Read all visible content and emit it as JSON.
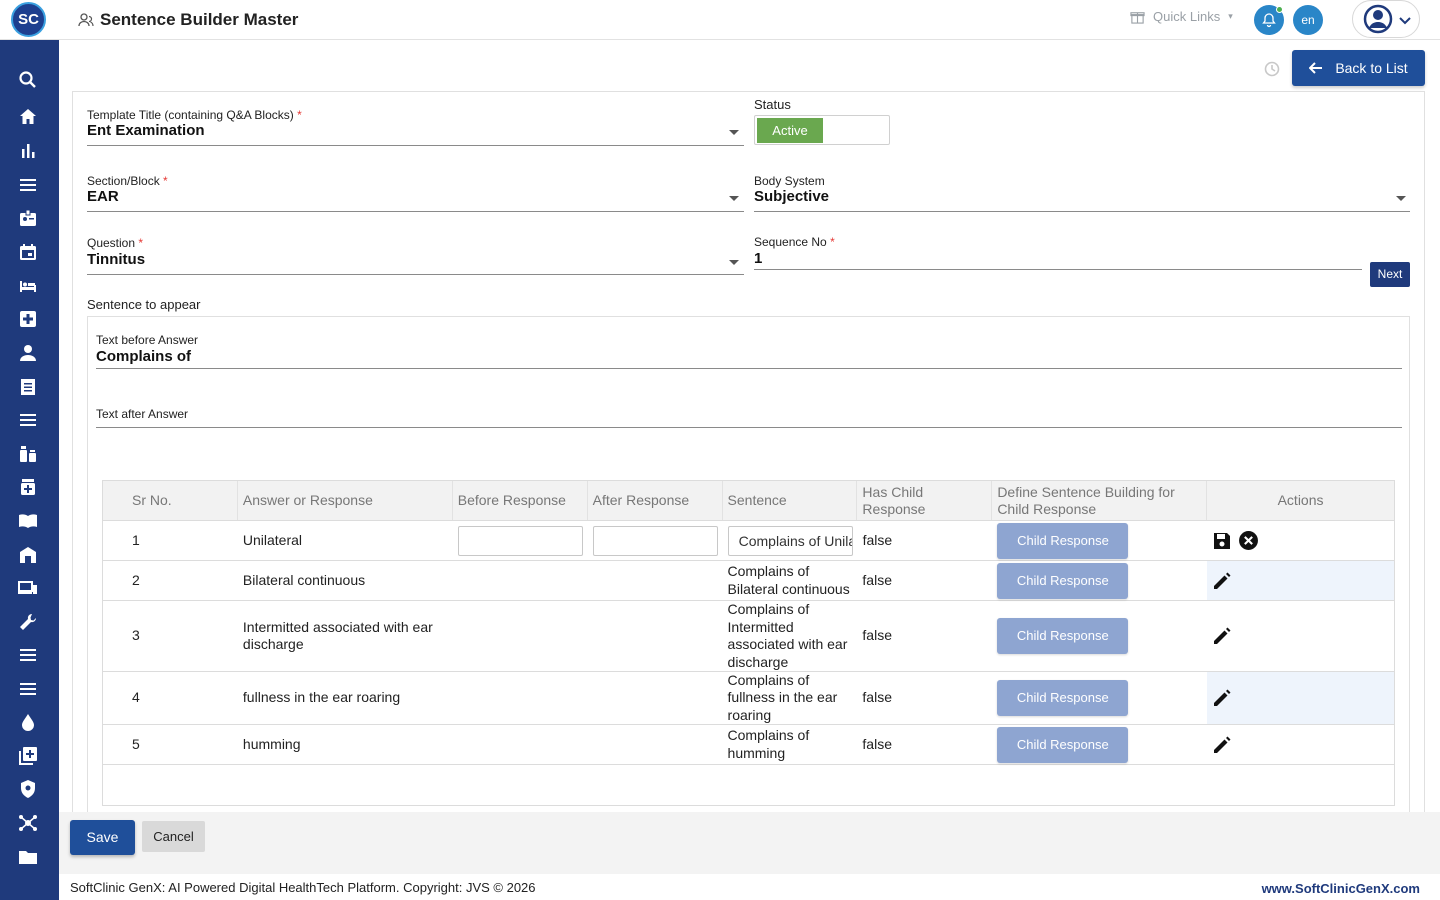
{
  "header": {
    "logo_text": "SC",
    "title": "Sentence Builder Master",
    "quick_links": "Quick Links",
    "lang": "en"
  },
  "actions": {
    "back_label": "Back to List"
  },
  "form": {
    "template_label": "Template Title (containing Q&A Blocks)",
    "template_value": "Ent Examination",
    "status_label": "Status",
    "status_value": "Active",
    "section_label": "Section/Block",
    "section_value": "EAR",
    "body_system_label": "Body System",
    "body_system_value": "Subjective",
    "question_label": "Question",
    "question_value": "Tinnitus",
    "sequence_label": "Sequence No",
    "sequence_value": "1",
    "next_label": "Next",
    "sentence_label": "Sentence to appear",
    "text_before_label": "Text before Answer",
    "text_before_value": "Complains of",
    "text_after_label": "Text after Answer",
    "text_after_value": "",
    "required_mark": "*"
  },
  "table": {
    "headers": [
      "Sr No.",
      "Answer or Response",
      "Before Response",
      "After Response",
      "Sentence",
      "Has Child Response",
      "Define Sentence Building for Child Response",
      "Actions"
    ],
    "child_button_label": "Child Response",
    "rows": [
      {
        "sr": "1",
        "answer": "Unilateral",
        "sentence": "Complains of  Unilateral",
        "has_child": "false",
        "editing": true
      },
      {
        "sr": "2",
        "answer": "Bilateral continuous",
        "sentence": "Complains of Bilateral continuous",
        "has_child": "false",
        "editing": false
      },
      {
        "sr": "3",
        "answer": "Intermitted associated with ear discharge",
        "sentence": "Complains of Intermitted associated with ear discharge",
        "has_child": "false",
        "editing": false
      },
      {
        "sr": "4",
        "answer": "fullness in the ear roaring",
        "sentence": "Complains of fullness in the ear roaring",
        "has_child": "false",
        "editing": false
      },
      {
        "sr": "5",
        "answer": "humming",
        "sentence": "Complains of humming",
        "has_child": "false",
        "editing": false
      }
    ]
  },
  "bottom": {
    "save_label": "Save",
    "cancel_label": "Cancel"
  },
  "footer": {
    "copyright": "SoftClinic GenX: AI Powered Digital HealthTech Platform. Copyright: JVS © 2026",
    "site": "www.SoftClinicGenX.com"
  },
  "sidebar_icons": [
    "search-icon",
    "home-icon",
    "bar-chart-icon",
    "menu-icon",
    "badge-icon",
    "calendar-icon",
    "bed-icon",
    "medical-plus-icon",
    "person-icon",
    "receipt-icon",
    "list-icon",
    "medication-icon",
    "pharmacy-icon",
    "book-icon",
    "building-icon",
    "devices-icon",
    "wrench-icon",
    "list-icon",
    "list-icon",
    "drop-icon",
    "add-box-icon",
    "shield-icon",
    "network-icon",
    "folder-icon"
  ],
  "colors": {
    "sidebar": "#1f3a7c",
    "primary": "#1f4f9a",
    "active_green": "#6aa84f",
    "child_button": "#8ea5d1"
  }
}
